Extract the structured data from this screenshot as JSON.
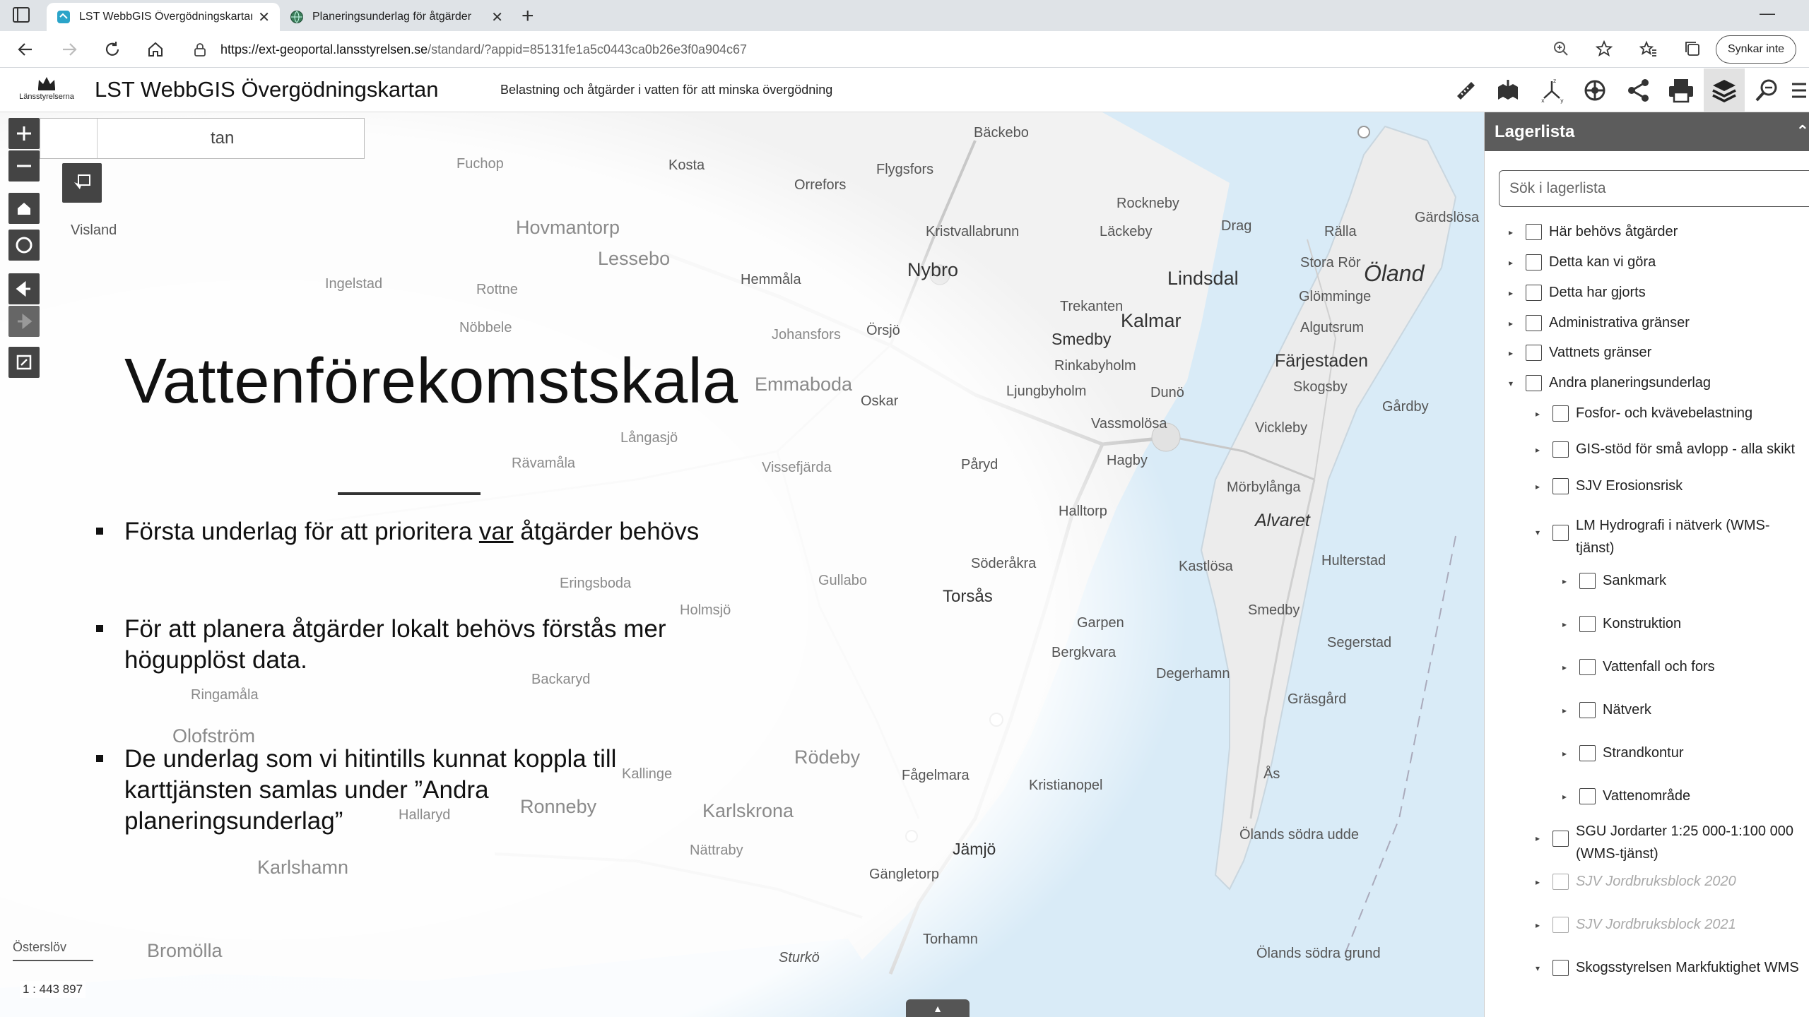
{
  "browser": {
    "tabs": [
      {
        "title": "LST WebbGIS Övergödningskartan",
        "active": true
      },
      {
        "title": "Planeringsunderlag för åtgärder",
        "active": false
      }
    ],
    "url_host": "https://ext-geoportal.lansstyrelsen.se",
    "url_path": "/standard/?appid=85131fe1a5c0443ca0b26e3f0a904c67",
    "sync_label": "Synkar inte"
  },
  "app": {
    "logo_text": "Länsstyrelserna",
    "title": "LST WebbGIS Övergödningskartan",
    "subtitle": "Belastning och åtgärder i vatten för att minska övergödning",
    "tools": [
      "ruler-icon",
      "basemap-icon",
      "coordinate-icon",
      "analysis-icon",
      "share-icon",
      "print-icon",
      "layers-icon",
      "zoom-search-icon",
      "list-icon"
    ]
  },
  "map": {
    "search_value": "tan",
    "scale_label": "Österslöv",
    "scale_value": "1 : 443 897",
    "places": [
      {
        "name": "Bäckebo"
      },
      {
        "name": "Kosta"
      },
      {
        "name": "Flygsfors"
      },
      {
        "name": "Orrefors"
      },
      {
        "name": "Fuchop"
      },
      {
        "name": "Rockneby"
      },
      {
        "name": "Drag"
      },
      {
        "name": "Gärdslösa"
      },
      {
        "name": "Visland"
      },
      {
        "name": "Hovmantorp"
      },
      {
        "name": "Lessebo"
      },
      {
        "name": "Kristvallabrunn"
      },
      {
        "name": "Läckeby"
      },
      {
        "name": "Rälla"
      },
      {
        "name": "Nybro"
      },
      {
        "name": "Lindsdal"
      },
      {
        "name": "Stora Rör"
      },
      {
        "name": "Öland"
      },
      {
        "name": "Ingelstad"
      },
      {
        "name": "Rottne"
      },
      {
        "name": "Hemmåla"
      },
      {
        "name": "Glömminge"
      },
      {
        "name": "Trekanten"
      },
      {
        "name": "Kalmar"
      },
      {
        "name": "Algutsrum"
      },
      {
        "name": "Nöbbele"
      },
      {
        "name": "Johansfors"
      },
      {
        "name": "Örsjö"
      },
      {
        "name": "Smedby"
      },
      {
        "name": "Färjestaden"
      },
      {
        "name": "Rinkabyholm"
      },
      {
        "name": "Skogsby"
      },
      {
        "name": "Emmaboda"
      },
      {
        "name": "Ljungbyholm"
      },
      {
        "name": "Dunö"
      },
      {
        "name": "Gårdby"
      },
      {
        "name": "Oskar"
      },
      {
        "name": "Vassmolösa"
      },
      {
        "name": "Vickleby"
      },
      {
        "name": "Långasjö"
      },
      {
        "name": "Rävamåla"
      },
      {
        "name": "Påryd"
      },
      {
        "name": "Hagby"
      },
      {
        "name": "Mörbylånga"
      },
      {
        "name": "Vissefjärda"
      },
      {
        "name": "Halltorp"
      },
      {
        "name": "Alvaret"
      },
      {
        "name": "Söderåkra"
      },
      {
        "name": "Kastlösa"
      },
      {
        "name": "Hulterstad"
      },
      {
        "name": "Eringsboda"
      },
      {
        "name": "Torsås"
      },
      {
        "name": "Gullabo"
      },
      {
        "name": "Garpen"
      },
      {
        "name": "Smedby"
      },
      {
        "name": "Bergkvara"
      },
      {
        "name": "Segerstad"
      },
      {
        "name": "Holmsjö"
      },
      {
        "name": "Degerhamn"
      },
      {
        "name": "Backaryd"
      },
      {
        "name": "Rödeby"
      },
      {
        "name": "Gräsgård"
      },
      {
        "name": "Ronneby"
      },
      {
        "name": "Karlskrona"
      },
      {
        "name": "Fågelmara"
      },
      {
        "name": "Kristianopel"
      },
      {
        "name": "Ås"
      },
      {
        "name": "Jämjö"
      },
      {
        "name": "Ölands södra udde"
      },
      {
        "name": "Karlshamn"
      },
      {
        "name": "Nättraby"
      },
      {
        "name": "Gängletorp"
      },
      {
        "name": "Sturkö"
      },
      {
        "name": "Torhamn"
      },
      {
        "name": "Ölands södra grund"
      },
      {
        "name": "Bromölla"
      },
      {
        "name": "Olofström"
      },
      {
        "name": "Ringamåla"
      },
      {
        "name": "Kallinge"
      },
      {
        "name": "Hallaryd"
      }
    ]
  },
  "slide": {
    "title": "Vattenförekomstskala",
    "bullets": [
      {
        "text_before": "Första underlag för att prioritera ",
        "underlined": "var",
        "text_after": " åtgärder behövs"
      },
      {
        "line1": "För att planera åtgärder lokalt behövs förstås mer",
        "line2": "högupplöst data."
      },
      {
        "line1": "De underlag som vi hitintills kunnat koppla till",
        "line2": "karttjänsten samlas under ”Andra",
        "line3": "planeringsunderlag”"
      }
    ]
  },
  "panel": {
    "title": "Lagerlista",
    "search_placeholder": "Sök i lagerlista",
    "layers": [
      {
        "label": "Här behövs åtgärder",
        "level": 0,
        "expanded": false
      },
      {
        "label": "Detta kan vi göra",
        "level": 0,
        "expanded": false
      },
      {
        "label": "Detta har gjorts",
        "level": 0,
        "expanded": false
      },
      {
        "label": "Administrativa gränser",
        "level": 0,
        "expanded": false
      },
      {
        "label": "Vattnets gränser",
        "level": 0,
        "expanded": false
      },
      {
        "label": "Andra planeringsunderlag",
        "level": 0,
        "expanded": true
      },
      {
        "label": "Fosfor- och kvävebelastning",
        "level": 1,
        "expanded": false
      },
      {
        "label": "GIS-stöd för små avlopp - alla skikt",
        "level": 1,
        "expanded": false
      },
      {
        "label": "SJV Erosionsrisk",
        "level": 1,
        "expanded": false
      },
      {
        "label": "LM Hydrografi i nätverk (WMS-",
        "label2": "tjänst)",
        "level": 1,
        "expanded": true
      },
      {
        "label": "Sankmark",
        "level": 2,
        "expanded": false
      },
      {
        "label": "Konstruktion",
        "level": 2,
        "expanded": false
      },
      {
        "label": "Vattenfall och fors",
        "level": 2,
        "expanded": false
      },
      {
        "label": "Nätverk",
        "level": 2,
        "expanded": false
      },
      {
        "label": "Strandkontur",
        "level": 2,
        "expanded": false
      },
      {
        "label": "Vattenområde",
        "level": 2,
        "expanded": false
      },
      {
        "label": "SGU Jordarter 1:25 000-1:100 000",
        "label2": "(WMS-tjänst)",
        "level": 1,
        "expanded": false
      },
      {
        "label": "SJV Jordbruksblock 2020",
        "level": 1,
        "expanded": false,
        "disabled": true
      },
      {
        "label": "SJV Jordbruksblock 2021",
        "level": 1,
        "expanded": false,
        "disabled": true
      },
      {
        "label": "Skogsstyrelsen Markfuktighet WMS",
        "level": 1,
        "expanded": true
      }
    ]
  }
}
